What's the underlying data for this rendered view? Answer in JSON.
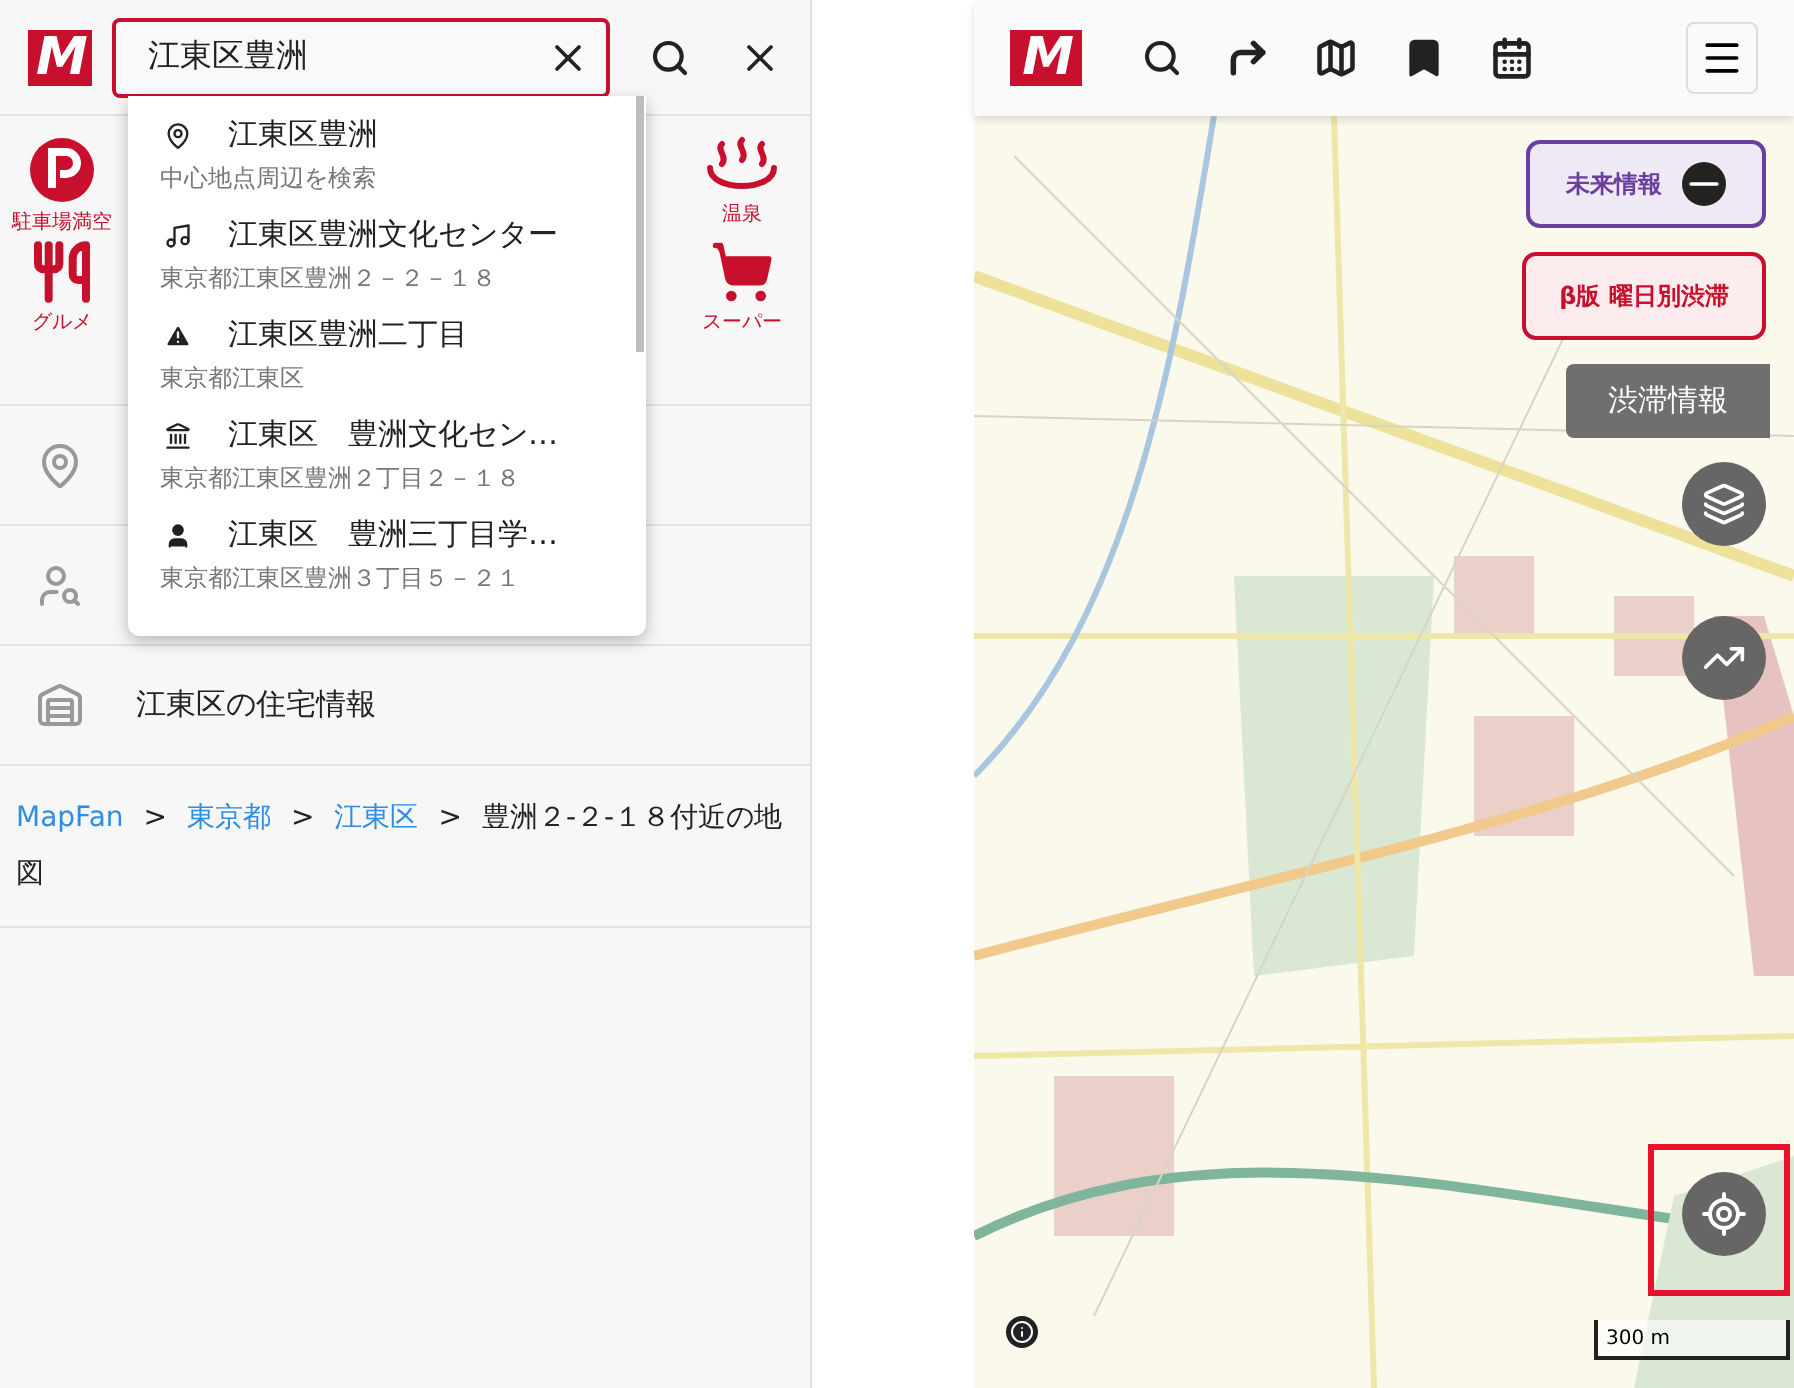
{
  "search": {
    "logo": "M",
    "value": "江東区豊洲"
  },
  "categories": [
    {
      "kind": "parking",
      "label": "駐車場満空"
    },
    {
      "kind": "onsen",
      "label": "温泉"
    },
    {
      "kind": "food",
      "label": "グルメ"
    },
    {
      "kind": "supermarket",
      "label": "スーパー"
    }
  ],
  "menu_rows": [
    {
      "kind": "nearby"
    },
    {
      "kind": "ai"
    },
    {
      "kind": "housing",
      "label": "江東区の住宅情報"
    }
  ],
  "breadcrumb": [
    {
      "kind": "link",
      "text": "MapFan"
    },
    {
      "kind": "separator",
      "text": ">"
    },
    {
      "kind": "link",
      "text": "東京都"
    },
    {
      "kind": "separator",
      "text": ">"
    },
    {
      "kind": "link",
      "text": "江東区"
    },
    {
      "kind": "separator",
      "text": ">"
    },
    {
      "kind": "current",
      "text": "豊洲２-２-１８付近の地図"
    }
  ],
  "suggestions": [
    {
      "kind": "place",
      "title": "江東区豊洲",
      "subtitle": "中心地点周辺を検索"
    },
    {
      "kind": "music",
      "title": "江東区豊洲文化センター",
      "subtitle": "東京都江東区豊洲２－２－１８"
    },
    {
      "kind": "warning",
      "title": "江東区豊洲二丁目",
      "subtitle": "東京都江東区"
    },
    {
      "kind": "building",
      "title": "江東区　豊洲文化セン…",
      "subtitle": "東京都江東区豊洲２丁目２－１８"
    },
    {
      "kind": "school",
      "title": "江東区　豊洲三丁目学…",
      "subtitle": "東京都江東区豊洲３丁目５－２１"
    }
  ],
  "map": {
    "logo": "M",
    "future_button": "未来情報",
    "weekday_button": "β版 曜日別渋滞",
    "traffic_button": "渋滞情報",
    "scale": "300 m"
  }
}
